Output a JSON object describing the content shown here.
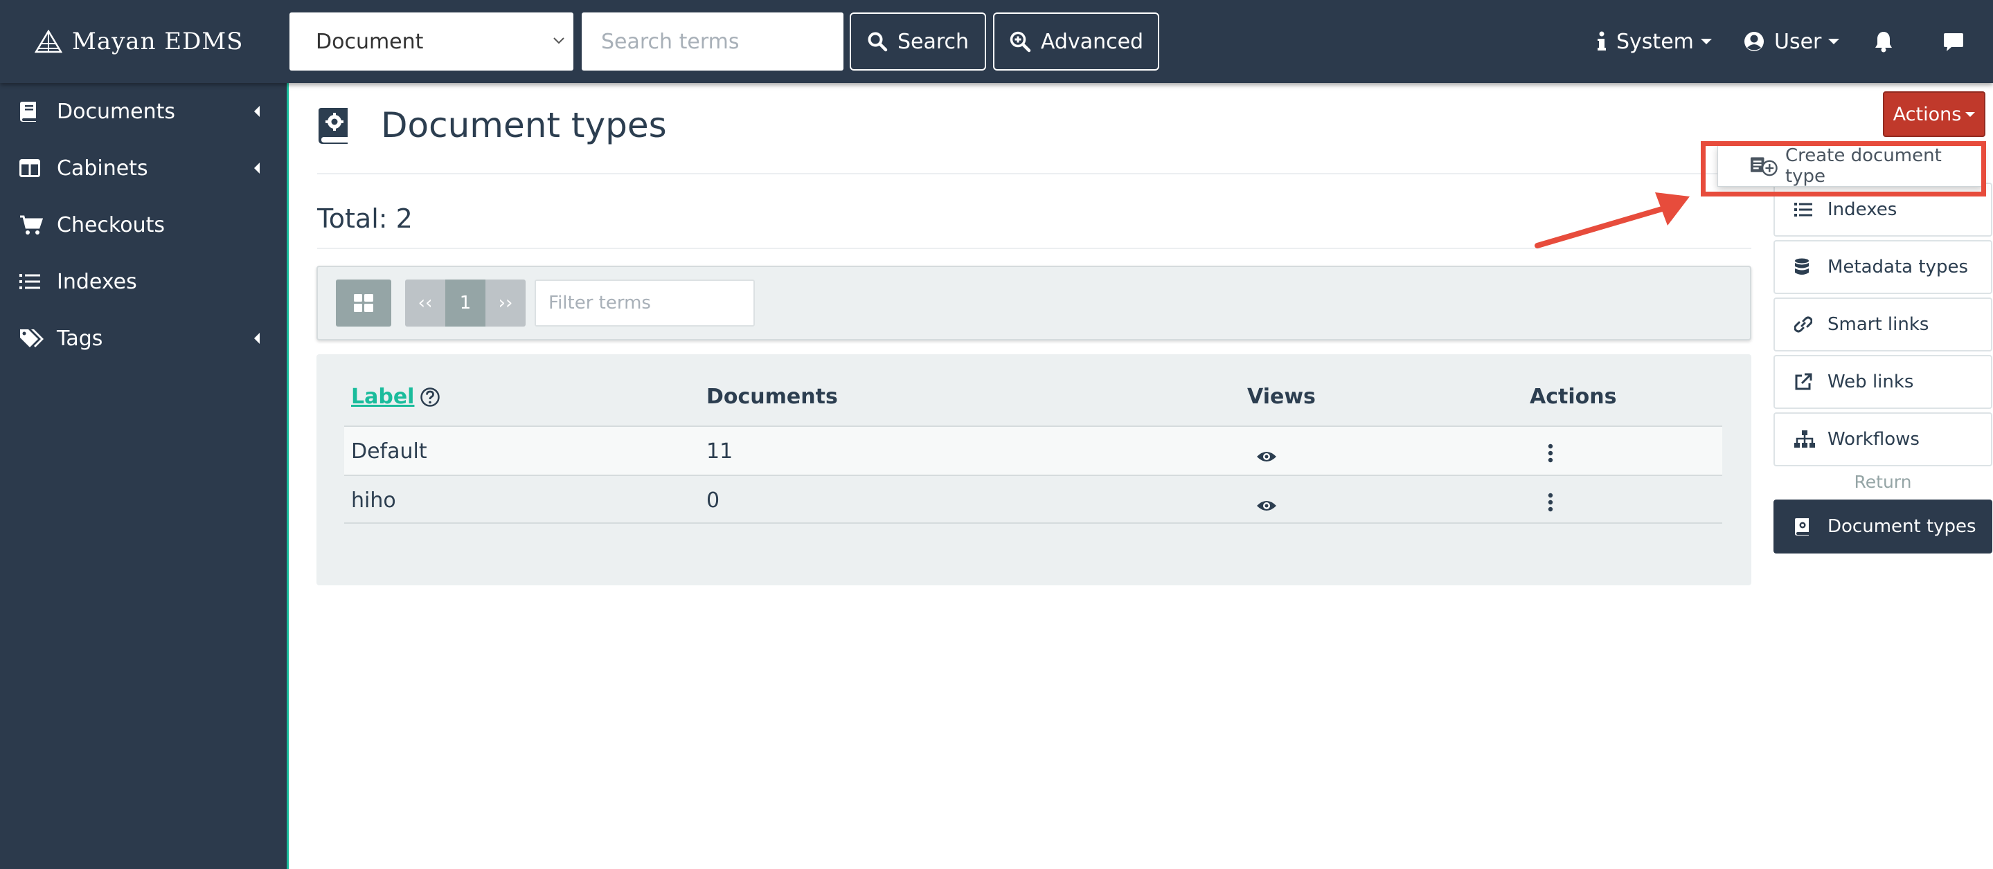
{
  "navbar": {
    "brand": "Mayan EDMS",
    "search_scope": "Document",
    "search_placeholder": "Search terms",
    "search_button": "Search",
    "advanced_button": "Advanced",
    "system_menu": "System",
    "user_menu": "User"
  },
  "sidebar": {
    "items": [
      {
        "label": "Documents",
        "icon": "book-icon",
        "has_submenu": true
      },
      {
        "label": "Cabinets",
        "icon": "columns-icon",
        "has_submenu": true
      },
      {
        "label": "Checkouts",
        "icon": "shopping-cart-icon",
        "has_submenu": false
      },
      {
        "label": "Indexes",
        "icon": "list-icon",
        "has_submenu": false
      },
      {
        "label": "Tags",
        "icon": "tags-icon",
        "has_submenu": true
      }
    ]
  },
  "main": {
    "title": "Document types",
    "total": "Total: 2",
    "pagination": {
      "prev": "‹‹",
      "current": "1",
      "next": "››"
    },
    "filter_placeholder": "Filter terms",
    "table": {
      "headers": {
        "label": "Label",
        "documents": "Documents",
        "views": "Views",
        "actions": "Actions"
      },
      "rows": [
        {
          "label": "Default",
          "documents": "11"
        },
        {
          "label": "hiho",
          "documents": "0"
        }
      ]
    }
  },
  "right_panel": {
    "actions_button": "Actions",
    "dropdown_item": "Create document type",
    "links": [
      {
        "label": "Indexes",
        "icon": "list-icon"
      },
      {
        "label": "Metadata types",
        "icon": "database-icon"
      },
      {
        "label": "Smart links",
        "icon": "link-icon"
      },
      {
        "label": "Web links",
        "icon": "external-link-icon"
      },
      {
        "label": "Workflows",
        "icon": "sitemap-icon"
      }
    ],
    "return_label": "Return",
    "active_link": "Document types"
  },
  "colors": {
    "navbar": "#2c3a4c",
    "accent": "#1abc9c",
    "actions_button": "#c0392b",
    "highlight": "#e74c3c"
  }
}
